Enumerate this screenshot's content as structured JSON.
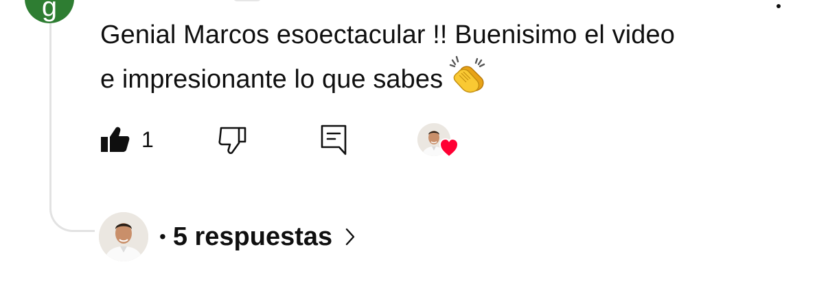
{
  "comment": {
    "avatar_letter": "g",
    "text_line1": "Genial Marcos esoectacular !! Buenisimo el video",
    "text_line2": "e impresionante lo que sabes",
    "emoji": "clapping-hands"
  },
  "actions": {
    "like_count": "1",
    "like_icon": "thumbs-up-filled-icon",
    "dislike_icon": "thumbs-down-icon",
    "reply_icon": "reply-icon",
    "creator_heart_icon": "creator-heart-icon"
  },
  "replies": {
    "bullet": "•",
    "label": "5 respuestas",
    "chevron": "chevron-right-icon"
  },
  "colors": {
    "avatar_green": "#2e7d32",
    "heart_red": "#ff0033",
    "text": "#0f0f0f",
    "thread_line": "#e2e2e2",
    "clap_yellow": "#f7c12c"
  }
}
